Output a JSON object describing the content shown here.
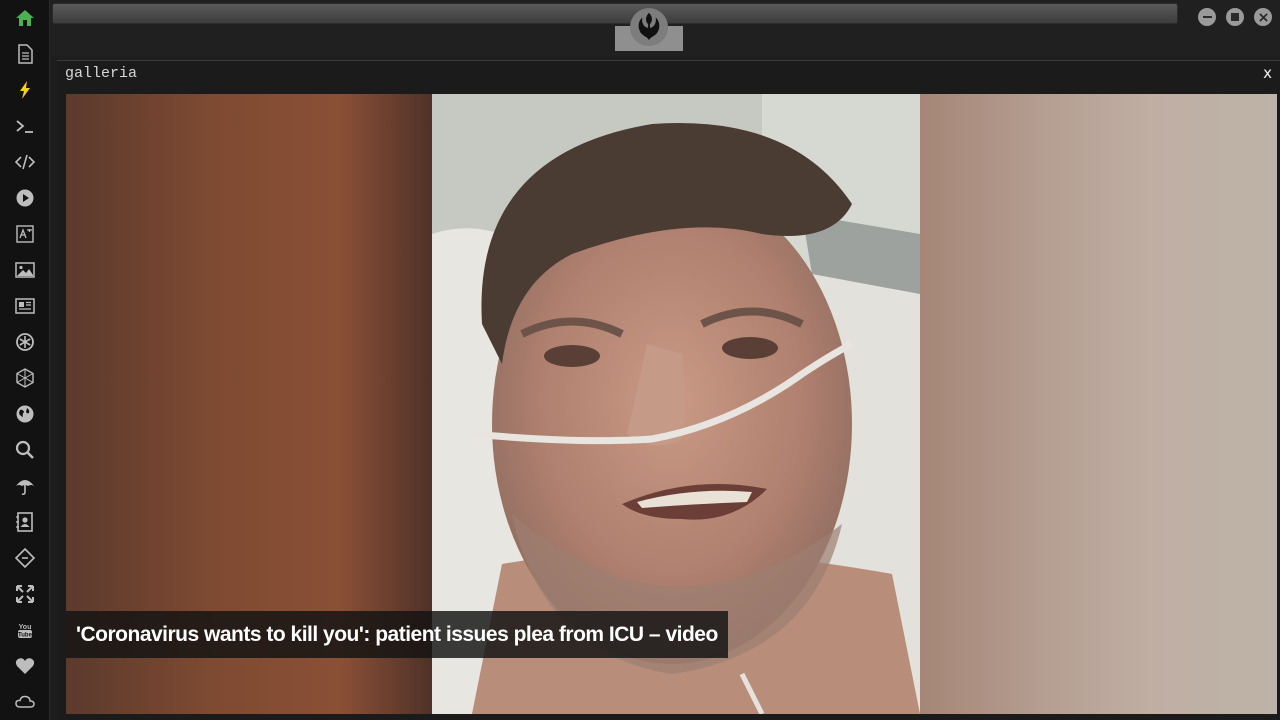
{
  "sidebar": {
    "items": [
      {
        "icon": "home-icon",
        "color": "#4caf50"
      },
      {
        "icon": "document-icon"
      },
      {
        "icon": "lightning-icon",
        "color": "#f5d020"
      },
      {
        "icon": "terminal-icon"
      },
      {
        "icon": "code-icon"
      },
      {
        "icon": "play-icon"
      },
      {
        "icon": "translate-icon"
      },
      {
        "icon": "image-icon"
      },
      {
        "icon": "newspaper-icon"
      },
      {
        "icon": "openai-icon"
      },
      {
        "icon": "network-icon"
      },
      {
        "icon": "globe-icon"
      },
      {
        "icon": "search-icon"
      },
      {
        "icon": "umbrella-icon"
      },
      {
        "icon": "contacts-icon"
      },
      {
        "icon": "git-icon"
      },
      {
        "icon": "expand-icon"
      },
      {
        "icon": "youtube-icon"
      },
      {
        "icon": "heart-icon"
      },
      {
        "icon": "cloud-icon"
      }
    ]
  },
  "topbar": {
    "logo": "rebel-alliance-icon"
  },
  "window": {
    "title": "galleria",
    "close_label": "x"
  },
  "gallery": {
    "caption": "'Coronavirus wants to kill you': patient issues plea from ICU – video"
  }
}
